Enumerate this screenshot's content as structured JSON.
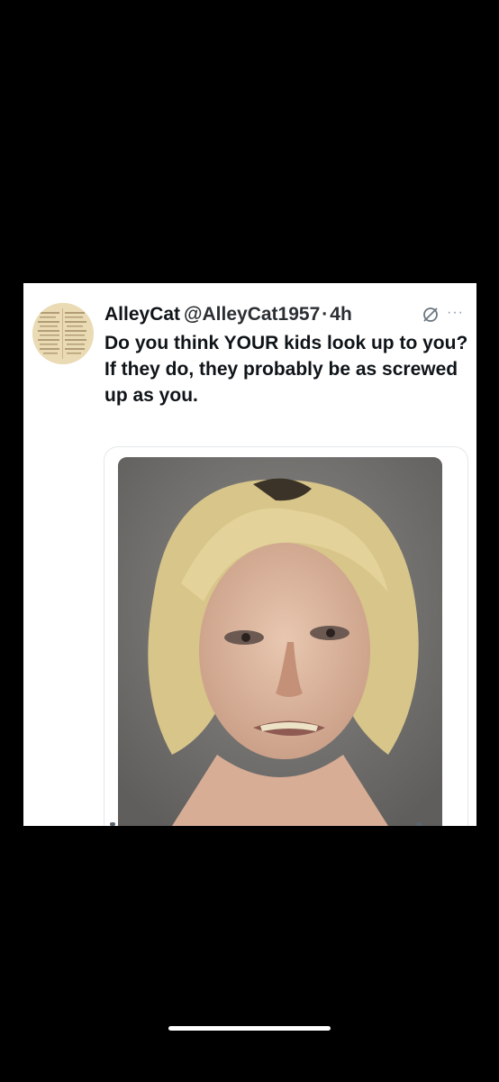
{
  "tweet": {
    "display_name": "AlleyCat",
    "handle": "@AlleyCat1957",
    "separator": "·",
    "time": "4h",
    "text_lines": [
      "Do you think YOUR kids look up to you?",
      "If they do, they probably be as screwed up as you."
    ],
    "more_label": "···"
  },
  "icons": {
    "avatar": "avatar-image",
    "grok": "grok-icon",
    "more": "more-options-icon"
  },
  "colors": {
    "background": "#000000",
    "card": "#ffffff",
    "text": "#0f1419",
    "muted": "#8b98a5"
  }
}
